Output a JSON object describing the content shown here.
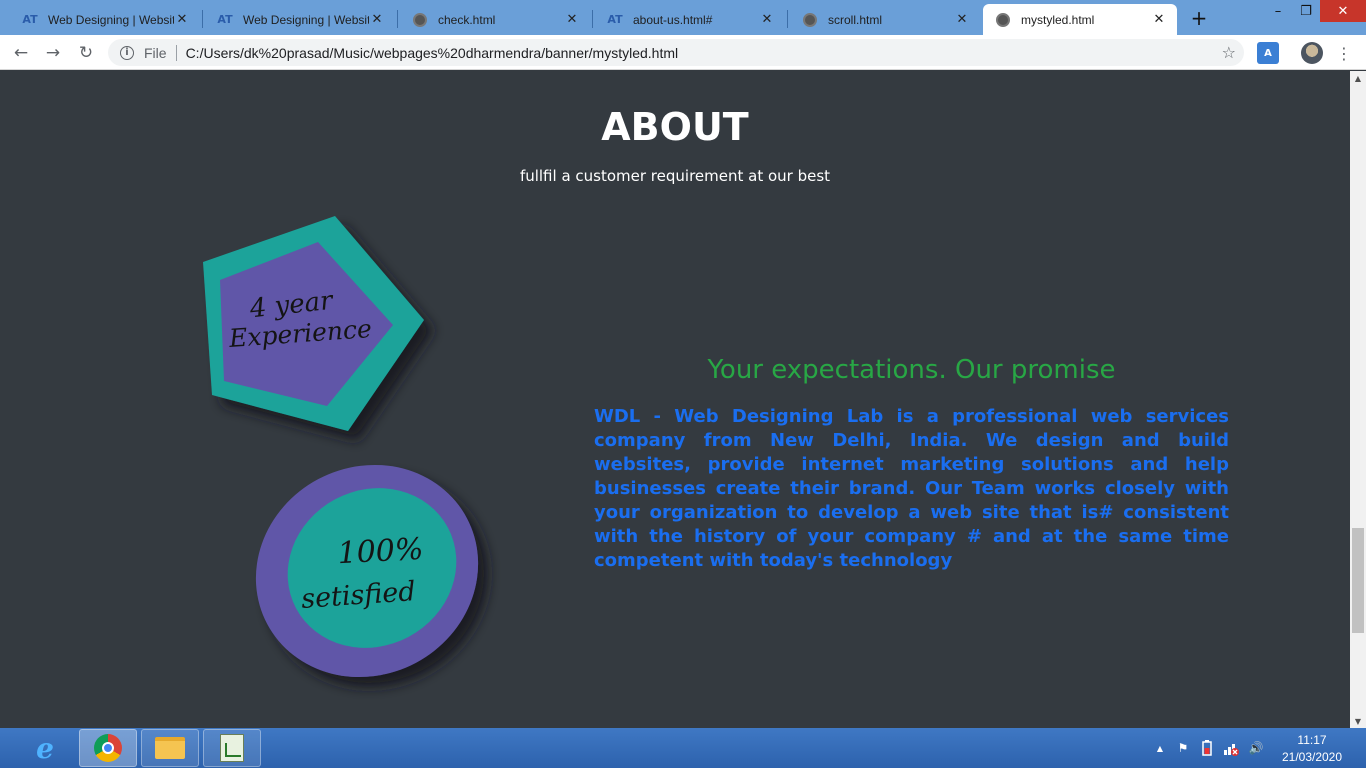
{
  "browser": {
    "tabs": [
      {
        "title": "Web Designing | Website",
        "icon": "AT",
        "close": "✕"
      },
      {
        "title": "Web Designing | Website",
        "icon": "AT",
        "close": "✕"
      },
      {
        "title": "check.html",
        "icon": "globe",
        "close": "✕"
      },
      {
        "title": "about-us.html#",
        "icon": "AT",
        "close": "✕"
      },
      {
        "title": "scroll.html",
        "icon": "globe",
        "close": "✕"
      },
      {
        "title": "mystyled.html",
        "icon": "globe",
        "close": "✕",
        "active": true
      }
    ],
    "new_tab": "+",
    "window_controls": {
      "minimize": "–",
      "maximize": "❐",
      "close": "✕"
    },
    "nav": {
      "back": "←",
      "forward": "→",
      "reload": "↻"
    },
    "address": {
      "info": "i",
      "scheme_label": "File",
      "url": "C:/Users/dk%20prasad/Music/webpages%20dharmendra/banner/mystyled.html",
      "star": "☆"
    },
    "extension_label": "A",
    "menu": "⋮"
  },
  "page": {
    "about_title": "ABOUT",
    "about_subtitle": "fullfil a customer requirement at our best",
    "badge1": {
      "line1": "4 year",
      "line2": "Experience"
    },
    "badge2": {
      "line1": "100%",
      "line2": "setisfied"
    },
    "promise_title": "Your expectations. Our promise",
    "promise_body": "WDL - Web Designing Lab is a professional web services company from New Delhi, India. We design and build websites, provide internet marketing solutions and help businesses create their brand. Our Team works closely with your organization to develop a web site that is# consistent with the history of your company # and at the same time competent with today's technology"
  },
  "colors": {
    "page_bg": "#343a40",
    "teal": "#1aa39a",
    "purple": "#6157a8",
    "promise_green": "#28a745",
    "promise_blue": "#1a6ef0"
  },
  "taskbar": {
    "pinned": [
      {
        "name": "internet-explorer-icon",
        "glyph": "e"
      },
      {
        "name": "chrome-icon"
      },
      {
        "name": "file-explorer-icon"
      },
      {
        "name": "notepad-icon"
      }
    ],
    "tray": {
      "show_hidden": "▲",
      "flag": "⚑",
      "volume": "🔊"
    },
    "clock": {
      "time": "11:17",
      "date": "21/03/2020"
    }
  },
  "scrollbar": {
    "up": "▲",
    "down": "▼"
  }
}
